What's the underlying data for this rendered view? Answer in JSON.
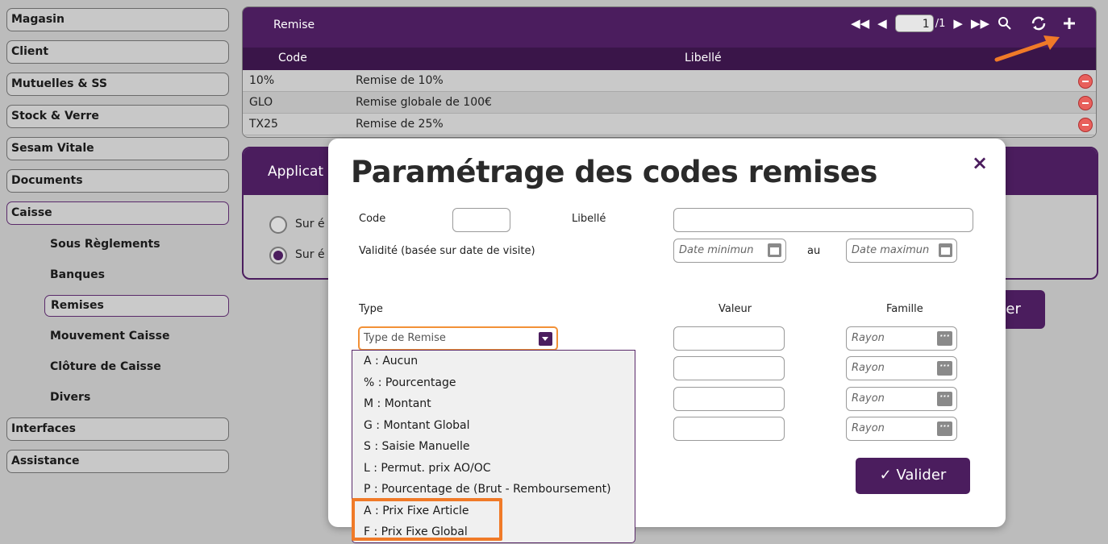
{
  "sidebar": {
    "items": [
      {
        "label": "Magasin"
      },
      {
        "label": "Client"
      },
      {
        "label": "Mutuelles & SS"
      },
      {
        "label": "Stock & Verre"
      },
      {
        "label": "Sesam Vitale"
      },
      {
        "label": "Documents"
      },
      {
        "label": "Caisse"
      }
    ],
    "caisse_sub": [
      {
        "label": "Sous Règlements"
      },
      {
        "label": "Banques"
      },
      {
        "label": "Remises"
      },
      {
        "label": "Mouvement Caisse"
      },
      {
        "label": "Clôture de Caisse"
      },
      {
        "label": "Divers"
      }
    ],
    "bottom": [
      {
        "label": "Interfaces"
      },
      {
        "label": "Assistance"
      }
    ]
  },
  "grid": {
    "title": "Remise",
    "page_value": "1",
    "page_total": "/1",
    "columns": {
      "code": "Code",
      "libelle": "Libellé"
    },
    "rows": [
      {
        "code": "10%",
        "libelle": "Remise de 10%"
      },
      {
        "code": "GLO",
        "libelle": "Remise globale de 100€"
      },
      {
        "code": "TX25",
        "libelle": "Remise de 25%"
      }
    ]
  },
  "app_panel": {
    "title": "Applicat",
    "radio1": "Sur é",
    "radio2": "Sur é",
    "button_fragment": "der"
  },
  "modal": {
    "title": "Paramétrage des codes remises",
    "close": "×",
    "code_label": "Code",
    "libelle_label": "Libellé",
    "validite_label": "Validité (basée sur date de visite)",
    "date_min_placeholder": "Date minimun",
    "au_label": "au",
    "date_max_placeholder": "Date maximun",
    "type_label": "Type",
    "valeur_label": "Valeur",
    "famille_label": "Famille",
    "type_select": "Type de Remise",
    "rayon": "Rayon",
    "valider": "✓  Valider",
    "dropdown_options": [
      "A : Aucun",
      "% : Pourcentage",
      "M : Montant",
      "G : Montant Global",
      "S : Saisie Manuelle",
      "L : Permut. prix AO/OC",
      "P : Pourcentage de (Brut - Remboursement)",
      "A : Prix Fixe Article",
      "F : Prix Fixe Global"
    ]
  },
  "colors": {
    "accent": "#4b1d5e",
    "highlight": "#f07a28"
  }
}
